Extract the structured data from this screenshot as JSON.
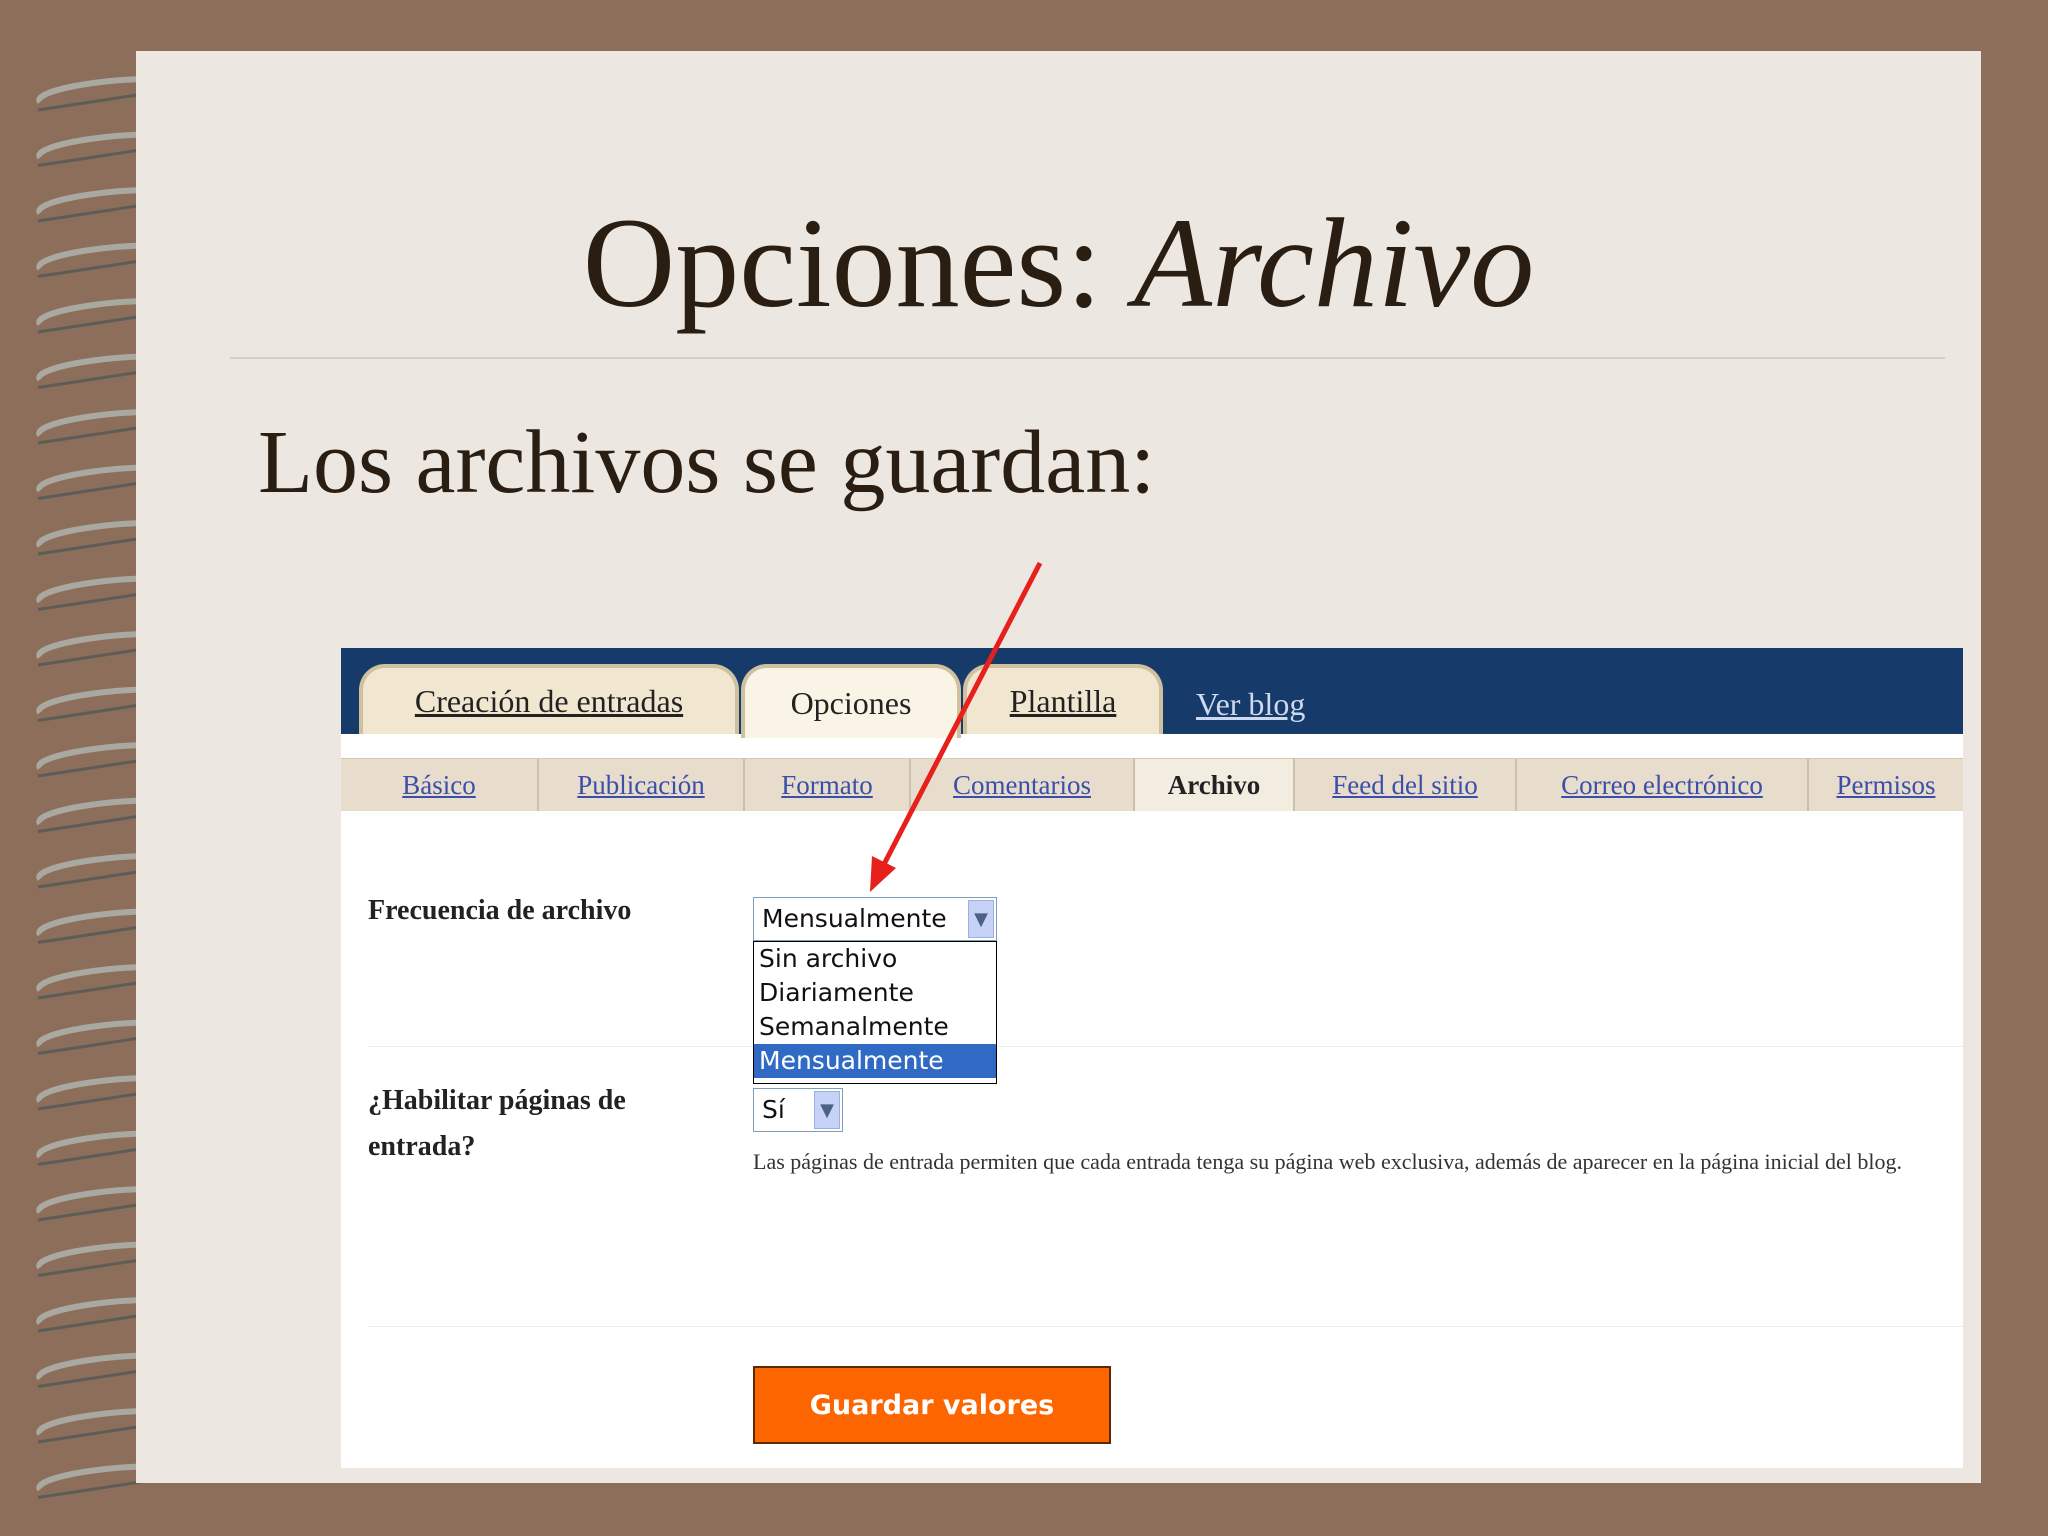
{
  "slide": {
    "title_plain": "Opciones: ",
    "title_italic": "Archivo",
    "subtitle": "Los archivos se guardan:"
  },
  "ui": {
    "main_tabs": [
      "Creación de entradas",
      "Opciones",
      "Plantilla",
      "Ver blog"
    ],
    "active_main_tab": "Opciones",
    "sub_tabs": [
      "Básico",
      "Publicación",
      "Formato",
      "Comentarios",
      "Archivo",
      "Feed del sitio",
      "Correo electrónico",
      "Permisos"
    ],
    "active_sub_tab": "Archivo",
    "archive_frequency": {
      "label": "Frecuencia de archivo",
      "selected": "Mensualmente",
      "options": [
        "Sin archivo",
        "Diariamente",
        "Semanalmente",
        "Mensualmente"
      ]
    },
    "entry_pages": {
      "label_line1": "¿Habilitar páginas de",
      "label_line2": "entrada?",
      "selected": "Sí",
      "description": "Las páginas de entrada permiten que cada entrada tenga su página web exclusiva, además de aparecer en la página inicial del blog."
    },
    "save_button": "Guardar valores"
  },
  "colors": {
    "background_frame": "#8d6e5a",
    "slide_bg": "#ede7e1",
    "nav_bar": "#163a6a",
    "link_blue": "#3b4fa8",
    "selected_option": "#316ac5",
    "save_button": "#fc6500",
    "annotation_arrow": "#e8201c"
  }
}
